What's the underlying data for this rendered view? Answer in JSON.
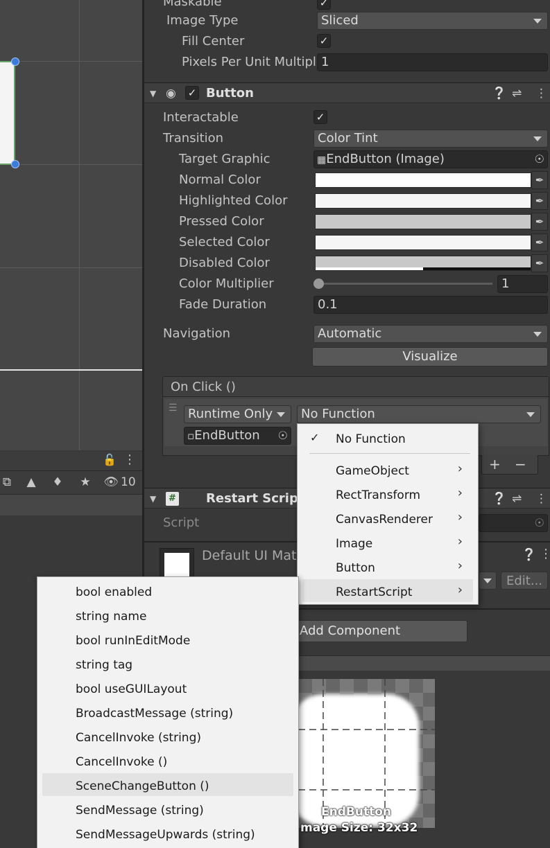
{
  "hierarchy": {
    "hidden_count": "10"
  },
  "inspector": {
    "image": {
      "maskable_label": "Maskable",
      "image_type_label": "Image Type",
      "image_type_value": "Sliced",
      "fill_center_label": "Fill Center",
      "ppu_label": "Pixels Per Unit Multipl",
      "ppu_value": "1"
    },
    "button": {
      "title": "Button",
      "interactable_label": "Interactable",
      "transition_label": "Transition",
      "transition_value": "Color Tint",
      "target_graphic_label": "Target Graphic",
      "target_graphic_value": "EndButton (Image)",
      "normal_color_label": "Normal Color",
      "highlighted_color_label": "Highlighted Color",
      "pressed_color_label": "Pressed Color",
      "selected_color_label": "Selected Color",
      "disabled_color_label": "Disabled Color",
      "color_multiplier_label": "Color Multiplier",
      "color_multiplier_value": "1",
      "fade_duration_label": "Fade Duration",
      "fade_duration_value": "0.1",
      "navigation_label": "Navigation",
      "navigation_value": "Automatic",
      "visualize_label": "Visualize",
      "onclick_label": "On Click ()",
      "runtime_value": "Runtime Only",
      "function_value": "No Function",
      "object_value": "EndButton",
      "colors": {
        "normal": "#ffffff",
        "highlighted": "#f5f5f5",
        "pressed": "#c8c8c8",
        "selected": "#f5f5f5",
        "disabled": "#c8c8c8"
      }
    },
    "restart_script": {
      "title": "Restart Script",
      "script_label": "Script"
    },
    "material": {
      "title": "Default UI Mat",
      "edit_label": "Edit..."
    },
    "add_component_label": "Add Component",
    "preview": {
      "name": "EndButton",
      "size": "mage Size: 32x32"
    }
  },
  "function_menu": {
    "items": [
      {
        "label": "No Function",
        "checked": true
      },
      {
        "label": "GameObject",
        "submenu": true
      },
      {
        "label": "RectTransform",
        "submenu": true
      },
      {
        "label": "CanvasRenderer",
        "submenu": true
      },
      {
        "label": "Image",
        "submenu": true
      },
      {
        "label": "Button",
        "submenu": true
      },
      {
        "label": "RestartScript",
        "submenu": true,
        "highlighted": true
      }
    ]
  },
  "submenu": {
    "items": [
      "bool enabled",
      "string name",
      "bool runInEditMode",
      "string tag",
      "bool useGUILayout",
      "BroadcastMessage (string)",
      "CancelInvoke (string)",
      "CancelInvoke ()",
      "SceneChangeButton ()",
      "SendMessage (string)",
      "SendMessageUpwards (string)"
    ],
    "highlighted_index": 8
  }
}
